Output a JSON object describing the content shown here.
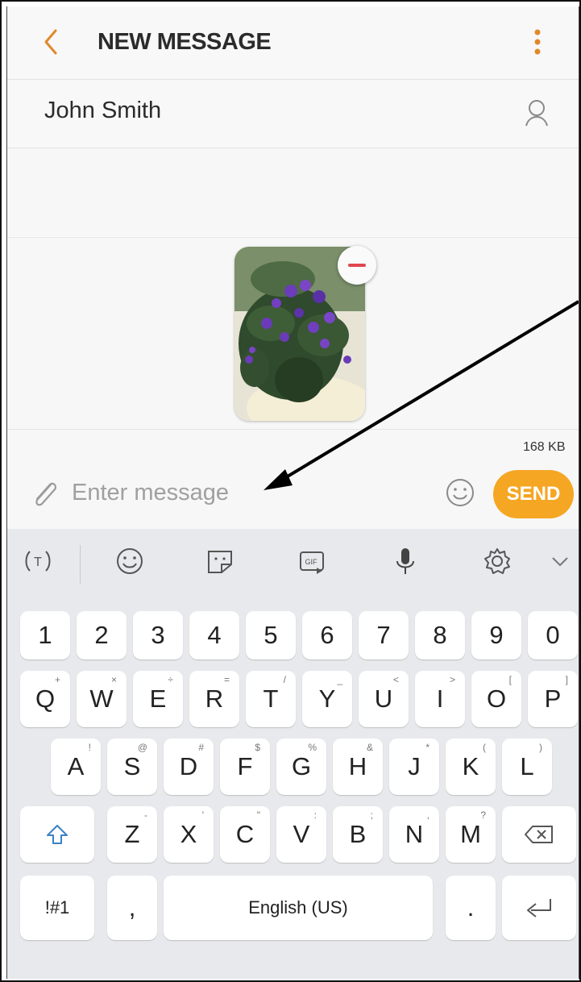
{
  "header": {
    "title": "NEW MESSAGE",
    "back_icon": "chevron-left-icon",
    "menu_icon": "more-vertical-icon",
    "accent_color": "#f5a623"
  },
  "recipient": {
    "name": "John Smith",
    "icon": "contact-icon"
  },
  "attachment": {
    "type": "image",
    "remove_icon": "remove-icon",
    "size_label": "168 KB"
  },
  "composer": {
    "placeholder": "Enter message",
    "attach_icon": "paperclip-icon",
    "emoji_icon": "emoji-icon",
    "send_label": "SEND"
  },
  "keyboard": {
    "toolbar": [
      "text-translate-icon",
      "emoji-icon",
      "sticker-icon",
      "gif-icon",
      "microphone-icon",
      "settings-icon",
      "collapse-icon"
    ],
    "row_numbers": [
      "1",
      "2",
      "3",
      "4",
      "5",
      "6",
      "7",
      "8",
      "9",
      "0"
    ],
    "row_q": [
      {
        "label": "Q",
        "hint": "+"
      },
      {
        "label": "W",
        "hint": "×"
      },
      {
        "label": "E",
        "hint": "÷"
      },
      {
        "label": "R",
        "hint": "="
      },
      {
        "label": "T",
        "hint": "/"
      },
      {
        "label": "Y",
        "hint": "_"
      },
      {
        "label": "U",
        "hint": "<"
      },
      {
        "label": "I",
        "hint": ">"
      },
      {
        "label": "O",
        "hint": "["
      },
      {
        "label": "P",
        "hint": "]"
      }
    ],
    "row_a": [
      {
        "label": "A",
        "hint": "!"
      },
      {
        "label": "S",
        "hint": "@"
      },
      {
        "label": "D",
        "hint": "#"
      },
      {
        "label": "F",
        "hint": "$"
      },
      {
        "label": "G",
        "hint": "%"
      },
      {
        "label": "H",
        "hint": "&"
      },
      {
        "label": "J",
        "hint": "*"
      },
      {
        "label": "K",
        "hint": "("
      },
      {
        "label": "L",
        "hint": ")"
      }
    ],
    "row_z": [
      {
        "label": "Z",
        "hint": "-"
      },
      {
        "label": "X",
        "hint": "'"
      },
      {
        "label": "C",
        "hint": "\""
      },
      {
        "label": "V",
        "hint": ":"
      },
      {
        "label": "B",
        "hint": ";"
      },
      {
        "label": "N",
        "hint": ","
      },
      {
        "label": "M",
        "hint": "?"
      }
    ],
    "symbols_label": "!#1",
    "comma_label": ",",
    "space_label": "English (US)",
    "period_label": "."
  }
}
